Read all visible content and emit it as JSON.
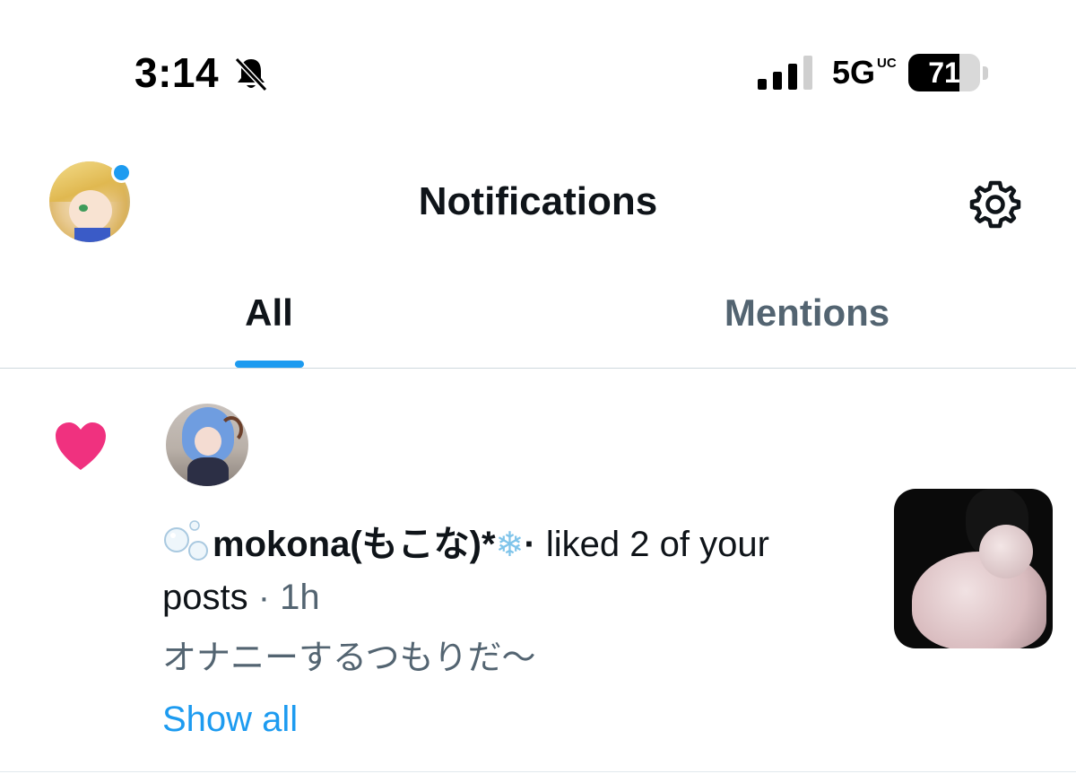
{
  "status_bar": {
    "time": "3:14",
    "network": "5G",
    "network_badge": "UC",
    "battery": "71",
    "battery_fraction": 0.71
  },
  "header": {
    "title": "Notifications"
  },
  "tabs": [
    {
      "label": "All",
      "active": true
    },
    {
      "label": "Mentions",
      "active": false
    }
  ],
  "notification": {
    "username": "mokona(もこな)*",
    "action": " liked 2 of your posts",
    "separator": " · ",
    "time": "1h",
    "post_text": "オナニーするつもりだ〜",
    "show_all": "Show all"
  },
  "colors": {
    "accent": "#1d9bf0",
    "like": "#f0317f",
    "secondary_text": "#536471"
  },
  "icons": {
    "mute": "bell-slash-icon",
    "settings": "gear-icon",
    "like": "heart-icon"
  }
}
